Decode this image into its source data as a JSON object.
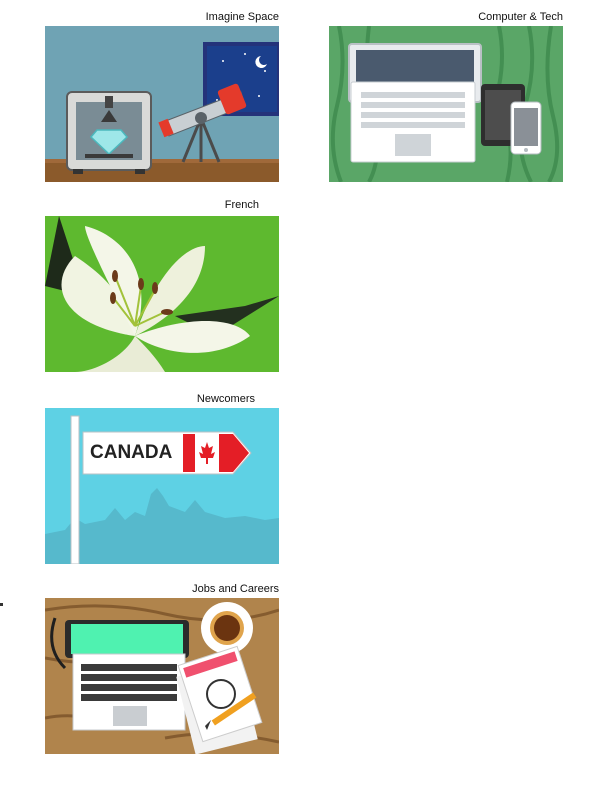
{
  "cards": [
    {
      "title": "Imagine Space",
      "theme": "3d-printer-and-telescope"
    },
    {
      "title": "Computer & Tech",
      "theme": "laptop-tablet-phone"
    },
    {
      "title": "French",
      "theme": "lily-flower"
    },
    {
      "title": "Newcomers",
      "theme": "canada-sign"
    },
    {
      "title": "Jobs and Careers",
      "theme": "desk-with-laptop-coffee-resume"
    }
  ],
  "sign_text": "CANADA",
  "colors": {
    "space_wall": "#6fa3b4",
    "space_shelf": "#8b5a2b",
    "tech_bg": "#5aa667",
    "french_bg": "#5eb92f",
    "canada_sky": "#5ed1e4",
    "canada_red": "#e41e26",
    "jobs_wood": "#b0844c",
    "laptop_screen_green": "#4ff2b0"
  }
}
